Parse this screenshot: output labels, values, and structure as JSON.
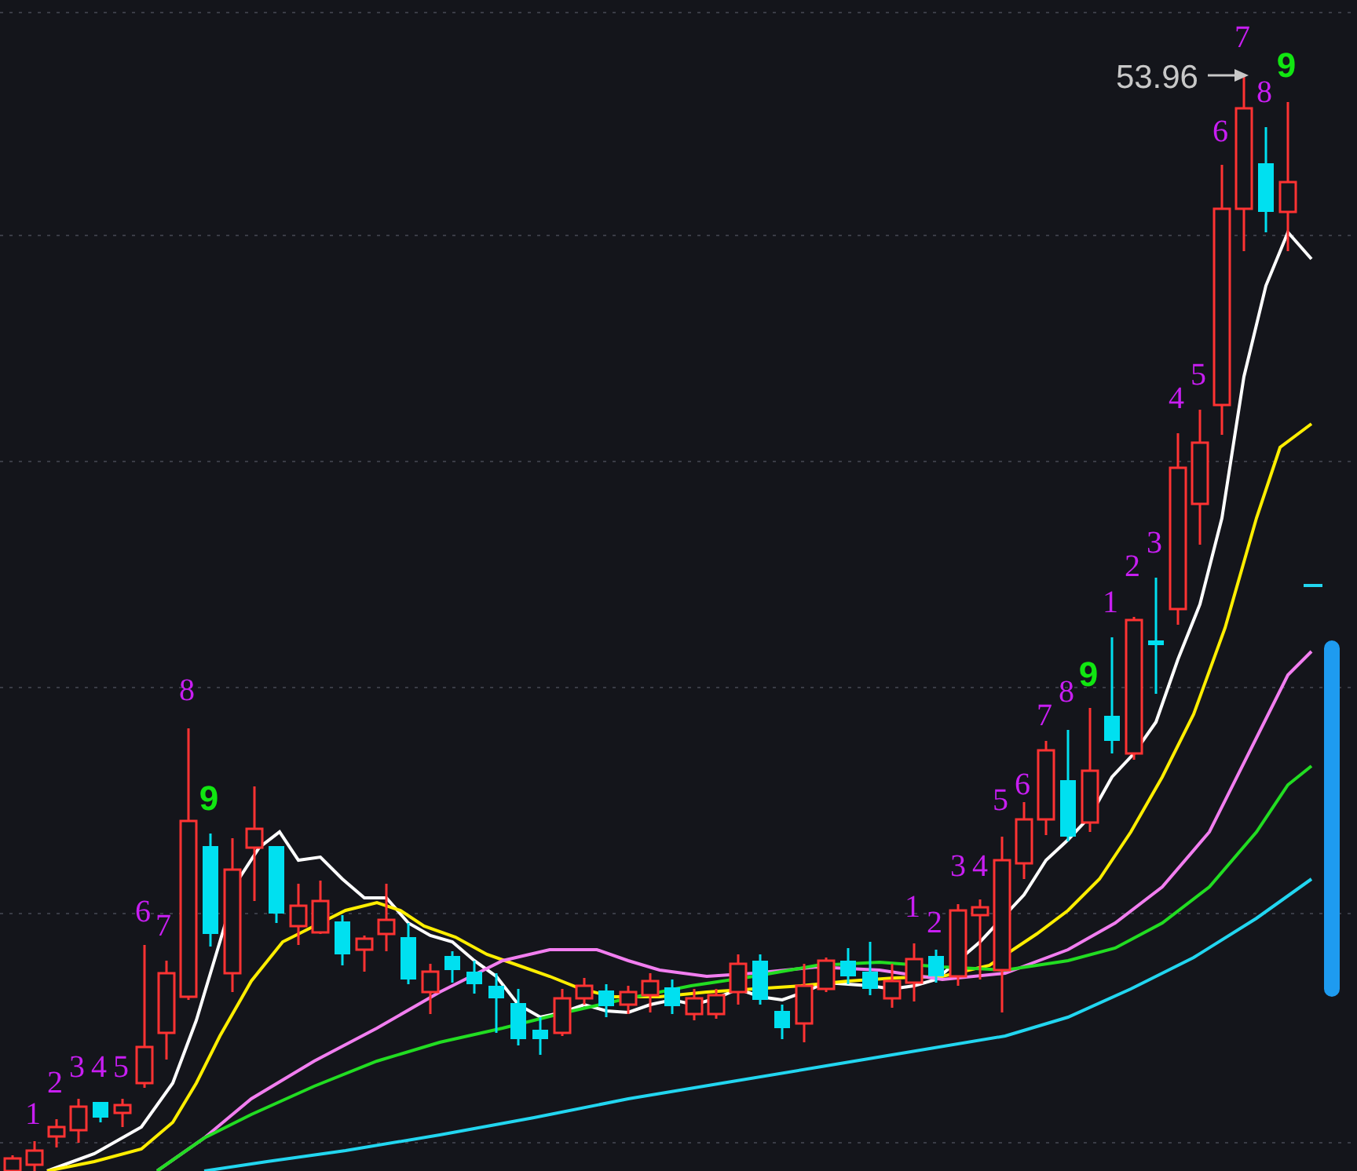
{
  "chart": {
    "price_label": "53.96",
    "sequences": [
      {
        "labels": [
          {
            "text": "1",
            "kind": "count"
          },
          {
            "text": "2",
            "kind": "count"
          },
          {
            "text": "3",
            "kind": "count"
          },
          {
            "text": "4",
            "kind": "count"
          },
          {
            "text": "5",
            "kind": "count"
          },
          {
            "text": "6",
            "kind": "count"
          },
          {
            "text": "7",
            "kind": "count"
          },
          {
            "text": "8",
            "kind": "count"
          },
          {
            "text": "9",
            "kind": "signal"
          }
        ]
      },
      {
        "labels": [
          {
            "text": "1",
            "kind": "count"
          },
          {
            "text": "2",
            "kind": "count"
          },
          {
            "text": "3",
            "kind": "count"
          },
          {
            "text": "4",
            "kind": "count"
          },
          {
            "text": "5",
            "kind": "count"
          },
          {
            "text": "6",
            "kind": "count"
          },
          {
            "text": "7",
            "kind": "count"
          },
          {
            "text": "8",
            "kind": "count"
          },
          {
            "text": "9",
            "kind": "signal"
          }
        ]
      },
      {
        "labels": [
          {
            "text": "1",
            "kind": "count"
          },
          {
            "text": "2",
            "kind": "count"
          },
          {
            "text": "3",
            "kind": "count"
          },
          {
            "text": "4",
            "kind": "count"
          },
          {
            "text": "5",
            "kind": "count"
          },
          {
            "text": "6",
            "kind": "count"
          },
          {
            "text": "7",
            "kind": "count"
          },
          {
            "text": "8",
            "kind": "count"
          },
          {
            "text": "9",
            "kind": "signal"
          }
        ]
      }
    ]
  }
}
